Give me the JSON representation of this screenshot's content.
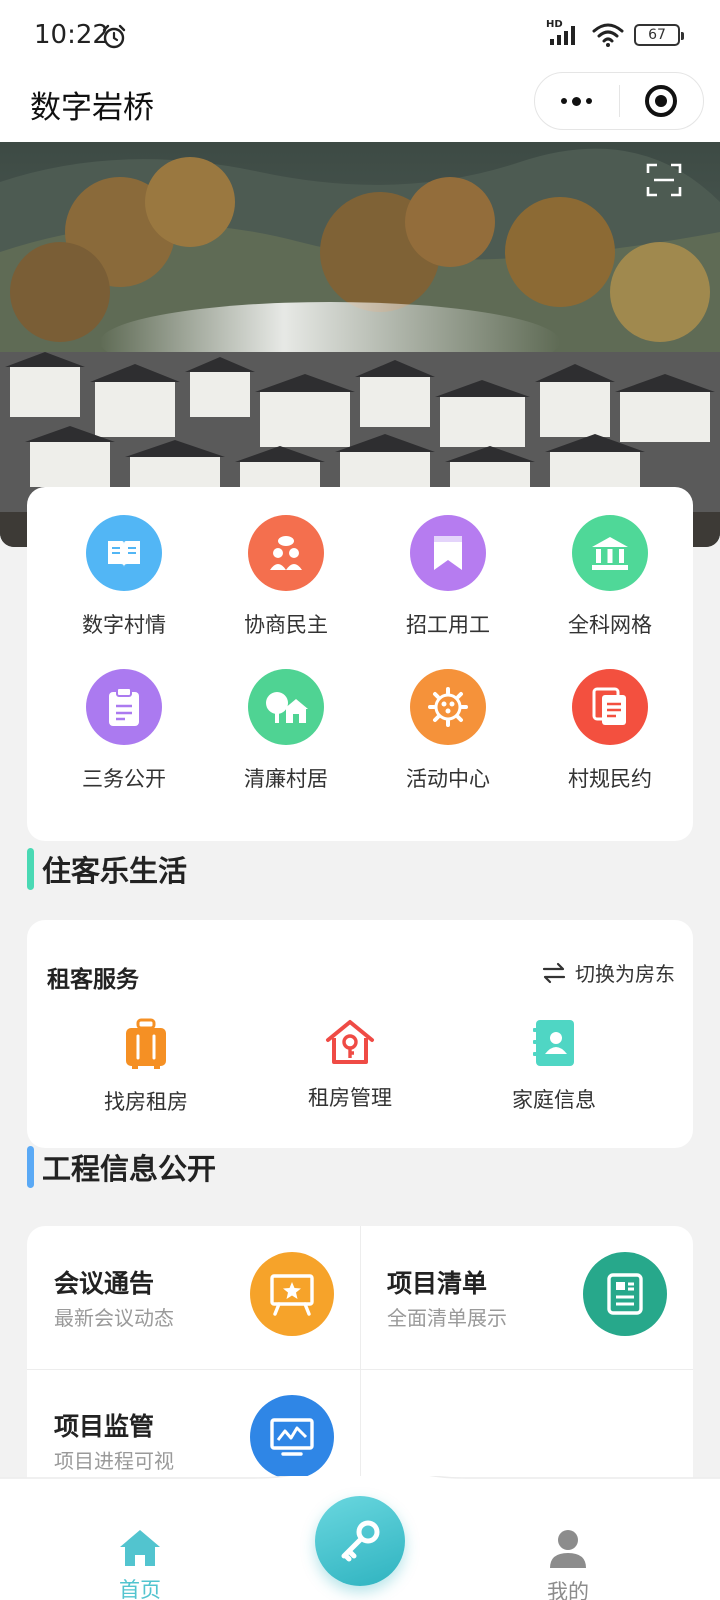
{
  "status_bar": {
    "time": "10:22",
    "signal_tag": "HD",
    "battery": "67"
  },
  "nav": {
    "title": "数字岩桥"
  },
  "grid": [
    {
      "label": "数字村情",
      "icon": "book-icon",
      "color": "#52b6f5"
    },
    {
      "label": "协商民主",
      "icon": "people-chat-icon",
      "color": "#f46f4e"
    },
    {
      "label": "招工用工",
      "icon": "bookmark-icon",
      "color": "#b67cf0"
    },
    {
      "label": "全科网格",
      "icon": "bank-icon",
      "color": "#4fd898"
    },
    {
      "label": "三务公开",
      "icon": "clipboard-icon",
      "color": "#ab7af0"
    },
    {
      "label": "清廉村居",
      "icon": "house-tree-icon",
      "color": "#4fd393"
    },
    {
      "label": "活动中心",
      "icon": "gear-icon",
      "color": "#f5923a"
    },
    {
      "label": "村规民约",
      "icon": "documents-icon",
      "color": "#f3503f"
    }
  ],
  "section1": {
    "title": "住客乐生活",
    "accent": "#4ad9b4"
  },
  "rent": {
    "title": "租客服务",
    "switch_label": "切换为房东",
    "items": [
      {
        "label": "找房租房",
        "icon": "luggage-icon"
      },
      {
        "label": "租房管理",
        "icon": "house-key-icon"
      },
      {
        "label": "家庭信息",
        "icon": "contact-book-icon"
      }
    ]
  },
  "section2": {
    "title": "工程信息公开",
    "accent": "#5aa9f5"
  },
  "projects": [
    {
      "title": "会议通告",
      "subtitle": "最新会议动态",
      "icon": "meeting-board-icon",
      "color": "#f6a32a"
    },
    {
      "title": "项目清单",
      "subtitle": "全面清单展示",
      "icon": "list-doc-icon",
      "color": "#27a88b"
    },
    {
      "title": "项目监管",
      "subtitle": "项目进程可视",
      "icon": "monitor-chart-icon",
      "color": "#2f86e6"
    }
  ],
  "tabbar": {
    "home_label": "首页",
    "mine_label": "我的",
    "active_color": "#52c4cf"
  }
}
